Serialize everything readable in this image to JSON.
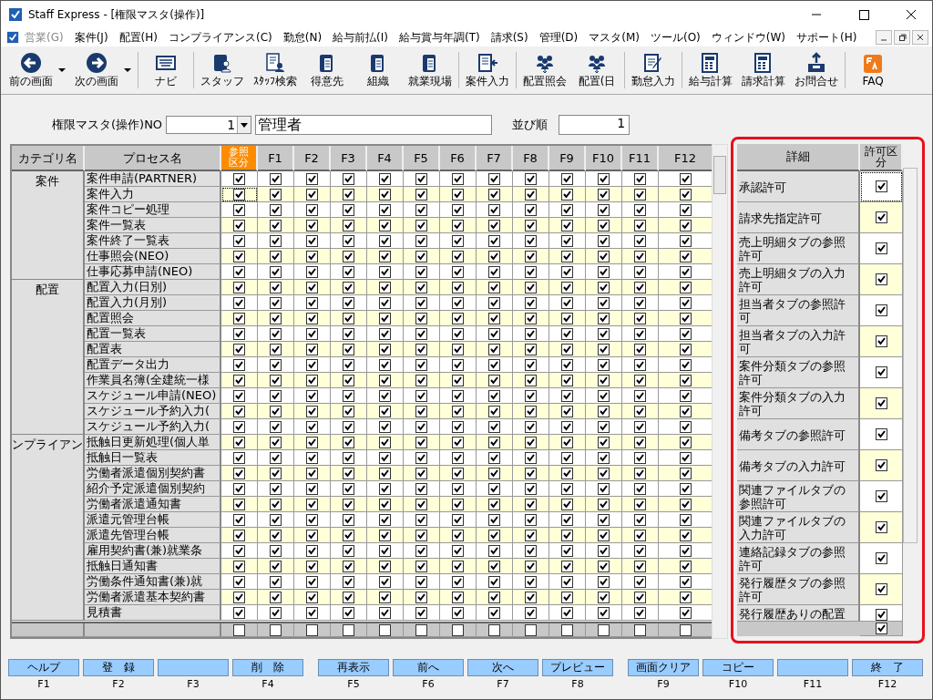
{
  "window": {
    "title": "Staff Express - [権限マスタ(操作)]"
  },
  "menu": [
    {
      "label": "営業(G)",
      "disabled": true
    },
    {
      "label": "案件(J)",
      "disabled": false
    },
    {
      "label": "配置(H)",
      "disabled": false
    },
    {
      "label": "コンプライアンス(C)",
      "disabled": false
    },
    {
      "label": "勤怠(N)",
      "disabled": false
    },
    {
      "label": "給与前払(I)",
      "disabled": false
    },
    {
      "label": "給与賞与年調(T)",
      "disabled": false
    },
    {
      "label": "請求(S)",
      "disabled": false
    },
    {
      "label": "管理(D)",
      "disabled": false
    },
    {
      "label": "マスタ(M)",
      "disabled": false
    },
    {
      "label": "ツール(O)",
      "disabled": false
    },
    {
      "label": "ウィンドウ(W)",
      "disabled": false
    },
    {
      "label": "サポート(H)",
      "disabled": false
    }
  ],
  "toolbar": [
    {
      "label": "前の画面",
      "kind": "back",
      "dropdown": true
    },
    {
      "label": "次の画面",
      "kind": "forward",
      "dropdown": true
    },
    {
      "label": "ナビ",
      "kind": "keyboard",
      "dropdown": false
    },
    {
      "label": "スタッフ",
      "kind": "person",
      "dropdown": false
    },
    {
      "label": "ｽﾀｯﾌ検索",
      "kind": "search-person",
      "dropdown": false
    },
    {
      "label": "得意先",
      "kind": "building",
      "dropdown": false
    },
    {
      "label": "組織",
      "kind": "building",
      "dropdown": false
    },
    {
      "label": "就業現場",
      "kind": "building",
      "dropdown": false
    },
    {
      "label": "案件入力",
      "kind": "doc-in",
      "dropdown": false
    },
    {
      "label": "配置照会",
      "kind": "people",
      "dropdown": false
    },
    {
      "label": "配置(日",
      "kind": "people",
      "dropdown": false
    },
    {
      "label": "勤怠入力",
      "kind": "edit",
      "dropdown": false
    },
    {
      "label": "給与計算",
      "kind": "calc",
      "dropdown": false
    },
    {
      "label": "請求計算",
      "kind": "calc",
      "dropdown": false
    },
    {
      "label": "お問合せ",
      "kind": "tray",
      "dropdown": false
    },
    {
      "label": "FAQ",
      "kind": "faq",
      "dropdown": false
    }
  ],
  "form": {
    "no_label": "権限マスタ(操作)NO",
    "no_value": "1",
    "name_value": "管理者",
    "order_label": "並び順",
    "order_value": "1"
  },
  "grid": {
    "columns": [
      "カテゴリ名",
      "プロセス名",
      "参照区分",
      "F1",
      "F2",
      "F3",
      "F4",
      "F5",
      "F6",
      "F7",
      "F8",
      "F9",
      "F10",
      "F11",
      "F12"
    ],
    "groups": [
      {
        "category": "案件",
        "rows": [
          {
            "process": "案件申請(PARTNER)",
            "checks": [
              true,
              true,
              true,
              true,
              true,
              true,
              true,
              true,
              true,
              true,
              true,
              true,
              true
            ]
          },
          {
            "process": "案件入力",
            "checks": [
              true,
              true,
              true,
              true,
              true,
              true,
              true,
              true,
              true,
              true,
              true,
              true,
              true
            ]
          },
          {
            "process": "案件コピー処理",
            "checks": [
              true,
              true,
              true,
              true,
              true,
              true,
              true,
              true,
              true,
              true,
              true,
              true,
              true
            ]
          },
          {
            "process": "案件一覧表",
            "checks": [
              true,
              true,
              true,
              true,
              true,
              true,
              true,
              true,
              true,
              true,
              true,
              true,
              true
            ]
          },
          {
            "process": "案件終了一覧表",
            "checks": [
              true,
              true,
              true,
              true,
              true,
              true,
              true,
              true,
              true,
              true,
              true,
              true,
              true
            ]
          },
          {
            "process": "仕事照会(NEO)",
            "checks": [
              true,
              true,
              true,
              true,
              true,
              true,
              true,
              true,
              true,
              true,
              true,
              true,
              true
            ]
          },
          {
            "process": "仕事応募申請(NEO)",
            "checks": [
              true,
              true,
              true,
              true,
              true,
              true,
              true,
              true,
              true,
              true,
              true,
              true,
              true
            ]
          }
        ]
      },
      {
        "category": "配置",
        "rows": [
          {
            "process": "配置入力(日別)",
            "checks": [
              true,
              true,
              true,
              true,
              true,
              true,
              true,
              true,
              true,
              true,
              true,
              true,
              true
            ]
          },
          {
            "process": "配置入力(月別)",
            "checks": [
              true,
              true,
              true,
              true,
              true,
              true,
              true,
              true,
              true,
              true,
              true,
              true,
              true
            ]
          },
          {
            "process": "配置照会",
            "checks": [
              true,
              true,
              true,
              true,
              true,
              true,
              true,
              true,
              true,
              true,
              true,
              true,
              true
            ]
          },
          {
            "process": "配置一覧表",
            "checks": [
              true,
              true,
              true,
              true,
              true,
              true,
              true,
              true,
              true,
              true,
              true,
              true,
              true
            ]
          },
          {
            "process": "配置表",
            "checks": [
              true,
              true,
              true,
              true,
              true,
              true,
              true,
              true,
              true,
              true,
              true,
              true,
              true
            ]
          },
          {
            "process": "配置データ出力",
            "checks": [
              true,
              true,
              true,
              true,
              true,
              true,
              true,
              true,
              true,
              true,
              true,
              true,
              true
            ]
          },
          {
            "process": "作業員名簿(全建統一様",
            "checks": [
              true,
              true,
              true,
              true,
              true,
              true,
              true,
              true,
              true,
              true,
              true,
              true,
              true
            ]
          },
          {
            "process": "スケジュール申請(NEO)",
            "checks": [
              true,
              true,
              true,
              true,
              true,
              true,
              true,
              true,
              true,
              true,
              true,
              true,
              true
            ]
          },
          {
            "process": "スケジュール予約入力(",
            "checks": [
              true,
              true,
              true,
              true,
              true,
              true,
              true,
              true,
              true,
              true,
              true,
              true,
              true
            ]
          },
          {
            "process": "スケジュール予約入力(",
            "checks": [
              true,
              true,
              true,
              true,
              true,
              true,
              true,
              true,
              true,
              true,
              true,
              true,
              true
            ]
          }
        ]
      },
      {
        "category": "ンプライアン",
        "rows": [
          {
            "process": "抵触日更新処理(個人単",
            "checks": [
              true,
              true,
              true,
              true,
              true,
              true,
              true,
              true,
              true,
              true,
              true,
              true,
              true
            ]
          },
          {
            "process": "抵触日一覧表",
            "checks": [
              true,
              true,
              true,
              true,
              true,
              true,
              true,
              true,
              true,
              true,
              true,
              true,
              true
            ]
          },
          {
            "process": "労働者派遣個別契約書",
            "checks": [
              true,
              true,
              true,
              true,
              true,
              true,
              true,
              true,
              true,
              true,
              true,
              true,
              true
            ]
          },
          {
            "process": "紹介予定派遣個別契約",
            "checks": [
              true,
              true,
              true,
              true,
              true,
              true,
              true,
              true,
              true,
              true,
              true,
              true,
              true
            ]
          },
          {
            "process": "労働者派遣通知書",
            "checks": [
              true,
              true,
              true,
              true,
              true,
              true,
              true,
              true,
              true,
              true,
              true,
              true,
              true
            ]
          },
          {
            "process": "派遣元管理台帳",
            "checks": [
              true,
              true,
              true,
              true,
              true,
              true,
              true,
              true,
              true,
              true,
              true,
              true,
              true
            ]
          },
          {
            "process": "派遣先管理台帳",
            "checks": [
              true,
              true,
              true,
              true,
              true,
              true,
              true,
              true,
              true,
              true,
              true,
              true,
              true
            ]
          },
          {
            "process": "雇用契約書(兼)就業条",
            "checks": [
              true,
              true,
              true,
              true,
              true,
              true,
              true,
              true,
              true,
              true,
              true,
              true,
              true
            ]
          },
          {
            "process": "抵触日通知書",
            "checks": [
              true,
              true,
              true,
              true,
              true,
              true,
              true,
              true,
              true,
              true,
              true,
              true,
              true
            ]
          },
          {
            "process": "労働条件通知書(兼)就",
            "checks": [
              true,
              true,
              true,
              true,
              true,
              true,
              true,
              true,
              true,
              true,
              true,
              true,
              true
            ]
          },
          {
            "process": "労働者派遣基本契約書",
            "checks": [
              true,
              true,
              true,
              true,
              true,
              true,
              true,
              true,
              true,
              true,
              true,
              true,
              true
            ]
          },
          {
            "process": "見積書",
            "checks": [
              true,
              true,
              true,
              true,
              true,
              true,
              true,
              true,
              true,
              true,
              true,
              true,
              true
            ]
          }
        ]
      }
    ],
    "footer_checks": [
      false,
      false,
      false,
      false,
      false,
      false,
      false,
      false,
      false,
      false,
      false,
      false,
      false
    ]
  },
  "details": {
    "columns": [
      "詳細",
      "許可区分"
    ],
    "rows": [
      {
        "label": "承認許可",
        "checked": true
      },
      {
        "label": "請求先指定許可",
        "checked": true
      },
      {
        "label": "売上明細タブの参照許可",
        "checked": true
      },
      {
        "label": "売上明細タブの入力許可",
        "checked": true
      },
      {
        "label": "担当者タブの参照許可",
        "checked": true
      },
      {
        "label": "担当者タブの入力許可",
        "checked": true
      },
      {
        "label": "案件分類タブの参照許可",
        "checked": true
      },
      {
        "label": "案件分類タブの入力許可",
        "checked": true
      },
      {
        "label": "備考タブの参照許可",
        "checked": true
      },
      {
        "label": "備考タブの入力許可",
        "checked": true
      },
      {
        "label": "関連ファイルタブの参照許可",
        "checked": true
      },
      {
        "label": "関連ファイルタブの入力許可",
        "checked": true
      },
      {
        "label": "連絡記録タブの参照許可",
        "checked": true
      },
      {
        "label": "発行履歴タブの参照許可",
        "checked": true
      },
      {
        "label": "発行履歴ありの配置",
        "checked": true
      }
    ],
    "footer_checked": true
  },
  "function_keys": [
    {
      "label": "ヘルプ",
      "key": "F1"
    },
    {
      "label": "登　録",
      "key": "F2"
    },
    {
      "key": "F3"
    },
    {
      "label": "削　除",
      "key": "F4"
    },
    {
      "label": "再表示",
      "key": "F5"
    },
    {
      "label": "前へ",
      "key": "F6"
    },
    {
      "label": "次へ",
      "key": "F7"
    },
    {
      "label": "プレビュー",
      "key": "F8"
    },
    {
      "label": "画面クリア",
      "key": "F9"
    },
    {
      "label": "コピー",
      "key": "F10"
    },
    {
      "key": "F11"
    },
    {
      "label": "終　了",
      "key": "F12"
    }
  ]
}
